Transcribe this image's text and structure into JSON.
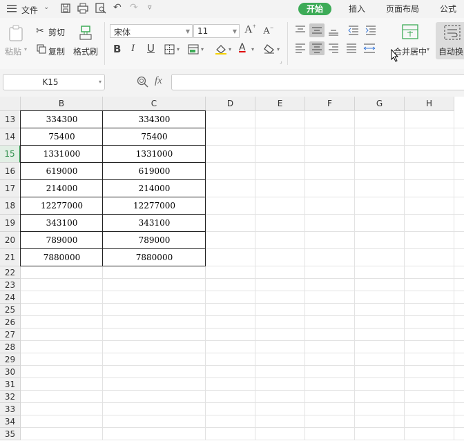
{
  "menu": {
    "file_label": "文件",
    "tabs": [
      {
        "label": "开始",
        "active": true
      },
      {
        "label": "插入",
        "active": false
      },
      {
        "label": "页面布局",
        "active": false
      },
      {
        "label": "公式",
        "active": false
      }
    ]
  },
  "ribbon": {
    "paste_label": "粘贴",
    "cut_label": "剪切",
    "copy_label": "复制",
    "format_painter_label": "格式刷",
    "font_name": "宋体",
    "font_size": "11",
    "merge_center_label": "合并居中",
    "wrap_text_label": "自动换"
  },
  "formula_bar": {
    "cell_ref": "K15",
    "fx_label": "fx",
    "formula_value": ""
  },
  "sheet": {
    "columns": [
      "B",
      "C",
      "D",
      "E",
      "F",
      "G",
      "H"
    ],
    "rows": [
      "13",
      "14",
      "15",
      "16",
      "17",
      "18",
      "19",
      "20",
      "21",
      "22",
      "23",
      "24",
      "25",
      "26",
      "27",
      "28",
      "29",
      "30",
      "31",
      "32",
      "33",
      "34",
      "35"
    ],
    "active_row": "15",
    "data": [
      [
        "334300",
        "334300"
      ],
      [
        "75400",
        "75400"
      ],
      [
        "1331000",
        "1331000"
      ],
      [
        "619000",
        "619000"
      ],
      [
        "214000",
        "214000"
      ],
      [
        "12277000",
        "12277000"
      ],
      [
        "343100",
        "343100"
      ],
      [
        "789000",
        "789000"
      ],
      [
        "7880000",
        "7880000"
      ]
    ]
  },
  "colors": {
    "accent_green": "#3dab57",
    "font_color_underline": "#e00000"
  }
}
